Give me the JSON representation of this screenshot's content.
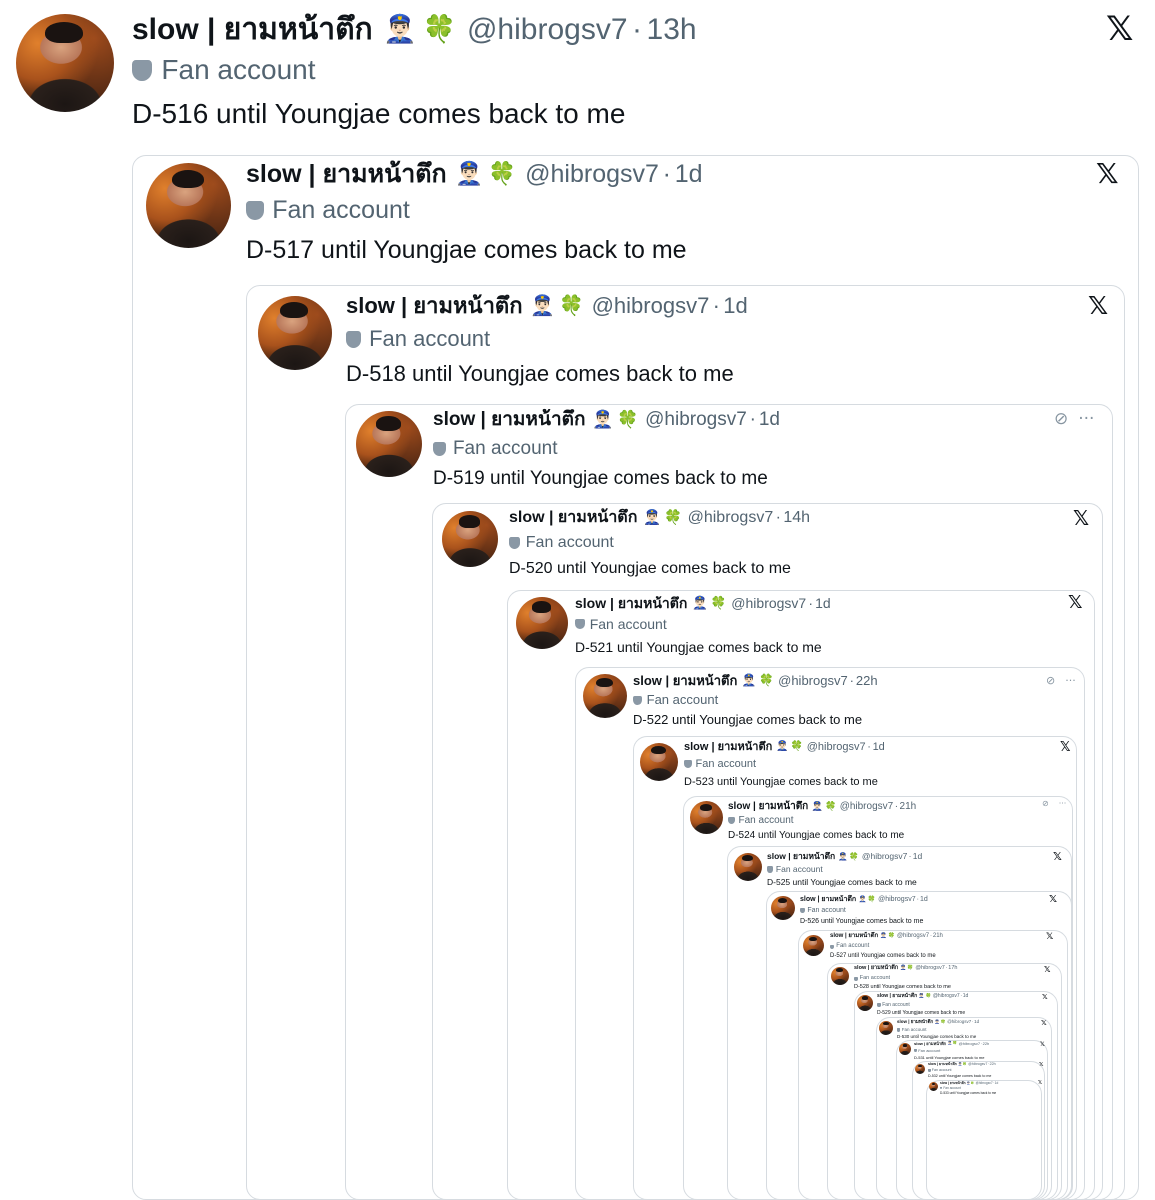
{
  "tweets": [
    {
      "name": "slow | ยามหน้าตึก",
      "emoji1": "👮🏻‍♂️",
      "emoji2": "🍀",
      "handle": "@hibrogsv7",
      "time": "13h",
      "badge": "Fan account",
      "text": "D-516 until Youngjae comes back to me",
      "corner": "x"
    },
    {
      "name": "slow | ยามหน้าตึก",
      "emoji1": "👮🏻‍♂️",
      "emoji2": "🍀",
      "handle": "@hibrogsv7",
      "time": "1d",
      "badge": "Fan account",
      "text": "D-517 until Youngjae comes back to me",
      "corner": "x"
    },
    {
      "name": "slow | ยามหน้าตึก",
      "emoji1": "👮🏻‍♂️",
      "emoji2": "🍀",
      "handle": "@hibrogsv7",
      "time": "1d",
      "badge": "Fan account",
      "text": "D-518 until Youngjae comes back to me",
      "corner": "x"
    },
    {
      "name": "slow | ยามหน้าตึก",
      "emoji1": "👮🏻‍♂️",
      "emoji2": "🍀",
      "handle": "@hibrogsv7",
      "time": "1d",
      "badge": "Fan account",
      "text": "D-519 until Youngjae comes back to me",
      "corner": "more"
    },
    {
      "name": "slow | ยามหน้าตึก",
      "emoji1": "👮🏻‍♂️",
      "emoji2": "🍀",
      "handle": "@hibrogsv7",
      "time": "14h",
      "badge": "Fan account",
      "text": "D-520 until Youngjae comes back to me",
      "corner": "x"
    },
    {
      "name": "slow | ยามหน้าตึก",
      "emoji1": "👮🏻‍♂️",
      "emoji2": "🍀",
      "handle": "@hibrogsv7",
      "time": "1d",
      "badge": "Fan account",
      "text": "D-521 until Youngjae comes back to me",
      "corner": "x"
    },
    {
      "name": "slow | ยามหน้าตึก",
      "emoji1": "👮🏻‍♂️",
      "emoji2": "🍀",
      "handle": "@hibrogsv7",
      "time": "22h",
      "badge": "Fan account",
      "text": "D-522 until Youngjae comes back to me",
      "corner": "more"
    },
    {
      "name": "slow | ยามหน้าตึก",
      "emoji1": "👮🏻‍♂️",
      "emoji2": "🍀",
      "handle": "@hibrogsv7",
      "time": "1d",
      "badge": "Fan account",
      "text": "D-523 until Youngjae comes back to me",
      "corner": "x"
    },
    {
      "name": "slow | ยามหน้าตึก",
      "emoji1": "👮🏻‍♂️",
      "emoji2": "🍀",
      "handle": "@hibrogsv7",
      "time": "21h",
      "badge": "Fan account",
      "text": "D-524 until Youngjae comes back to me",
      "corner": "more"
    },
    {
      "name": "slow | ยามหน้าตึก",
      "emoji1": "👮🏻‍♂️",
      "emoji2": "🍀",
      "handle": "@hibrogsv7",
      "time": "1d",
      "badge": "Fan account",
      "text": "D-525 until Youngjae comes back to me",
      "corner": "x"
    },
    {
      "name": "slow | ยามหน้าตึก",
      "emoji1": "👮🏻‍♂️",
      "emoji2": "🍀",
      "handle": "@hibrogsv7",
      "time": "1d",
      "badge": "Fan account",
      "text": "D-526 until Youngjae comes back to me",
      "corner": "x"
    },
    {
      "name": "slow | ยามหน้าตึก",
      "emoji1": "👮🏻‍♂️",
      "emoji2": "🍀",
      "handle": "@hibrogsv7",
      "time": "21h",
      "badge": "Fan account",
      "text": "D-527 until Youngjae comes back to me",
      "corner": "x"
    },
    {
      "name": "slow | ยามหน้าตึก",
      "emoji1": "👮🏻‍♂️",
      "emoji2": "🍀",
      "handle": "@hibrogsv7",
      "time": "17h",
      "badge": "Fan account",
      "text": "D-528 until Youngjae comes back to me",
      "corner": "x"
    },
    {
      "name": "slow | ยามหน้าตึก",
      "emoji1": "👮🏻‍♂️",
      "emoji2": "🍀",
      "handle": "@hibrogsv7",
      "time": "1d",
      "badge": "Fan account",
      "text": "D-529 until Youngjae comes back to me",
      "corner": "x"
    },
    {
      "name": "slow | ยามหน้าตึก",
      "emoji1": "👮🏻‍♂️",
      "emoji2": "🍀",
      "handle": "@hibrogsv7",
      "time": "1d",
      "badge": "Fan account",
      "text": "D-530 until Youngjae comes back to me",
      "corner": "x"
    },
    {
      "name": "slow | ยามหน้าตึก",
      "emoji1": "👮🏻‍♂️",
      "emoji2": "🍀",
      "handle": "@hibrogsv7",
      "time": "22h",
      "badge": "Fan account",
      "text": "D-531 until Youngjae comes back to me",
      "corner": "x"
    },
    {
      "name": "slow | ยามหน้าตึก",
      "emoji1": "👮🏻‍♂️",
      "emoji2": "🍀",
      "handle": "@hibrogsv7",
      "time": "22h",
      "badge": "Fan account",
      "text": "D-532 until Youngjae comes back to me",
      "corner": "x"
    },
    {
      "name": "slow | ยามหน้าตึก",
      "emoji1": "👮🏻‍♂️",
      "emoji2": "🍀",
      "handle": "@hibrogsv7",
      "time": "1d",
      "badge": "Fan account",
      "text": "D-533 until Youngjae comes back to me",
      "corner": "x"
    }
  ],
  "icons": {
    "x_logo": "x-logo-icon",
    "more": "more-icon",
    "grok": "grok-icon",
    "shield": "shield-icon"
  },
  "colors": {
    "text": "#0f1419",
    "muted": "#536471",
    "border": "#d6dbe0",
    "badge": "#8a98a5"
  }
}
